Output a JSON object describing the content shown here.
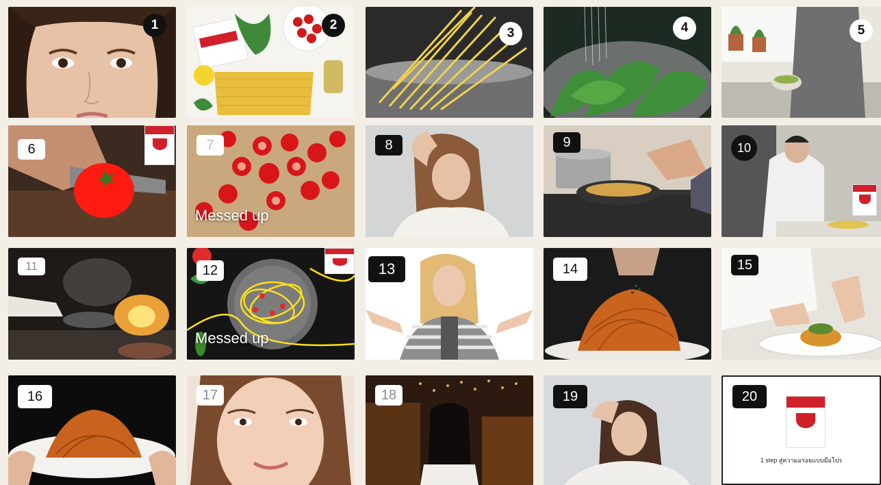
{
  "tiles": [
    {
      "number": "1"
    },
    {
      "number": "2"
    },
    {
      "number": "3"
    },
    {
      "number": "4"
    },
    {
      "number": "5"
    },
    {
      "number": "6"
    },
    {
      "number": "7",
      "note": "Messed up"
    },
    {
      "number": "8"
    },
    {
      "number": "9"
    },
    {
      "number": "10"
    },
    {
      "number": "11"
    },
    {
      "number": "12",
      "note": "Messed up"
    },
    {
      "number": "13"
    },
    {
      "number": "14"
    },
    {
      "number": "15"
    },
    {
      "number": "16"
    },
    {
      "number": "17"
    },
    {
      "number": "18"
    },
    {
      "number": "19"
    },
    {
      "number": "20",
      "caption": "1 step สู่ความอร่อยแบบมือโปร"
    }
  ]
}
